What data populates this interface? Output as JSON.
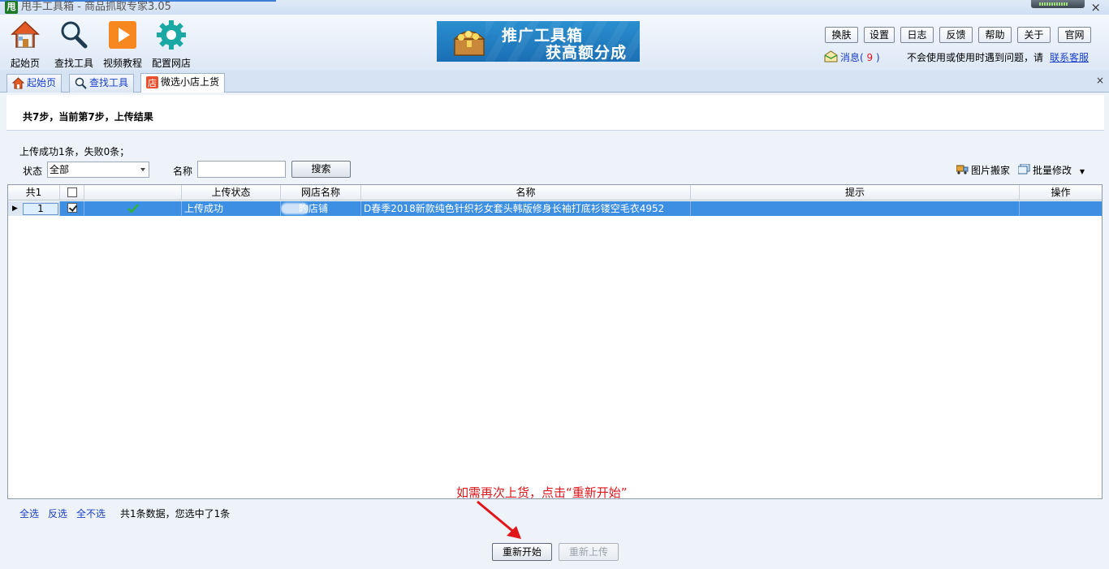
{
  "window": {
    "app_badge": "甩",
    "title": "甩手工具箱 - 商品抓取专家3.05",
    "close_glyph": "×"
  },
  "toolbar": {
    "buttons": [
      {
        "label": "起始页",
        "icon": "home-icon"
      },
      {
        "label": "查找工具",
        "icon": "magnifier-icon"
      },
      {
        "label": "视频教程",
        "icon": "play-icon"
      },
      {
        "label": "配置网店",
        "icon": "gear-icon"
      }
    ],
    "banner": {
      "line1": "推广工具箱",
      "line2": "获高额分成",
      "icon": "treasure-chest-icon"
    },
    "links": [
      "换肤",
      "设置",
      "日志",
      "反馈",
      "帮助",
      "关于",
      "官网"
    ],
    "message": {
      "label": "消息(",
      "count": " 9 ",
      "close": ")",
      "icon": "envelope-icon"
    },
    "help_text": "不会使用或使用时遇到问题，请",
    "support_link": "联系客服"
  },
  "tabs": {
    "items": [
      {
        "label": "起始页",
        "icon": "home-icon",
        "active": false
      },
      {
        "label": "查找工具",
        "icon": "magnifier-icon",
        "active": false
      },
      {
        "label": "微选小店上货",
        "icon": "store-icon",
        "active": true
      }
    ],
    "close_glyph": "×"
  },
  "main": {
    "step_text": "共7步，当前第7步，上传结果",
    "summary": "上传成功1条，失败0条；",
    "filter": {
      "status_label": "状态",
      "status_value": "全部",
      "name_label": "名称",
      "name_value": "",
      "search_button": "搜索"
    },
    "tools": {
      "image_move": "图片搬家",
      "batch_edit": "批量修改"
    }
  },
  "grid": {
    "columns": {
      "rownum": "共1",
      "upload_status": "上传状态",
      "shop_name": "网店名称",
      "name": "名称",
      "hint": "提示",
      "action": "操作"
    },
    "rows": [
      {
        "rownum": "1",
        "checked": true,
        "status_icon": "check-icon",
        "upload_status": "上传成功",
        "shop_name": "旳店铺",
        "name": "D春季2018新款纯色针织衫女套头韩版修身长袖打底衫镂空毛衣4952",
        "hint": "",
        "action": ""
      }
    ]
  },
  "footer": {
    "select_all": "全选",
    "invert": "反选",
    "select_none": "全不选",
    "count_text": "共1条数据，您选中了1条",
    "annotation": "如需再次上货，点击“重新开始”",
    "restart_button": "重新开始",
    "reupload_button": "重新上传"
  },
  "colors": {
    "accent": "#3d8fe3",
    "annotation_red": "#e0161b",
    "link_blue": "#1a3ec8"
  }
}
